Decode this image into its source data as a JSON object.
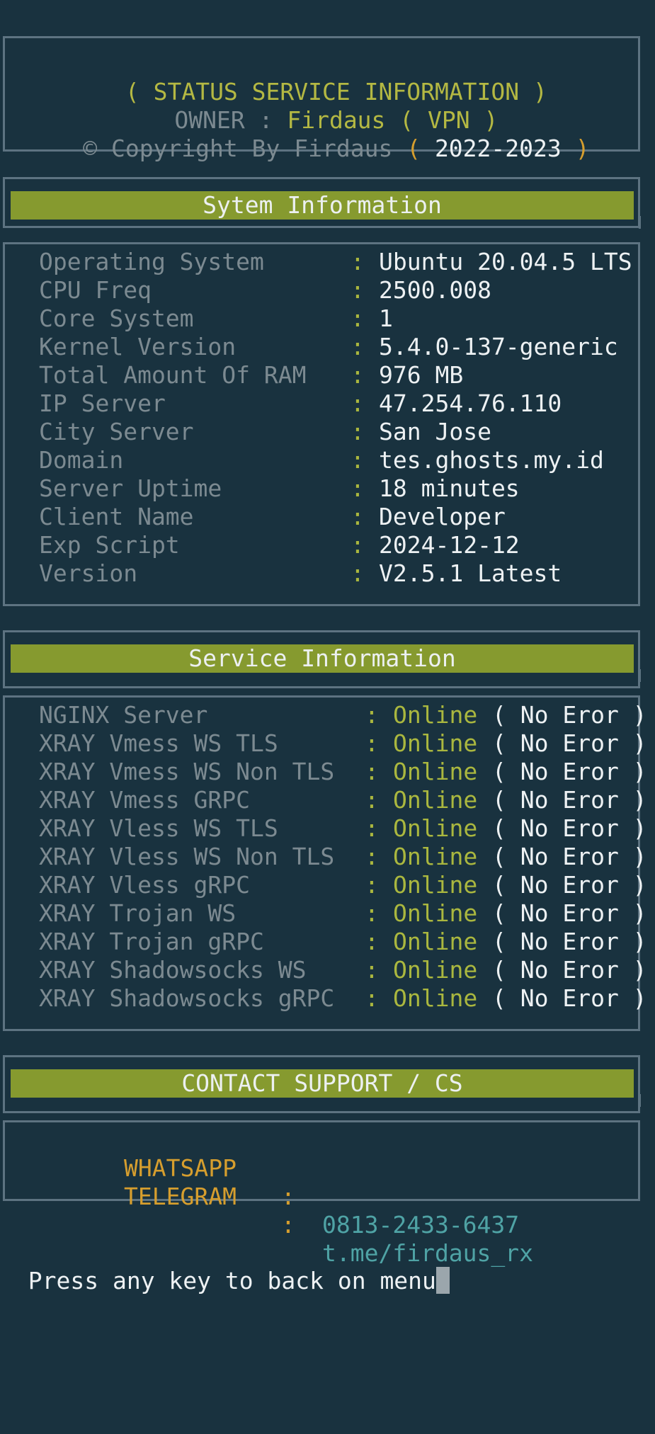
{
  "header": {
    "title_open": "( ",
    "title": "STATUS SERVICE INFORMATION",
    "title_close": " )",
    "owner_label": "OWNER",
    "owner_sep": " : ",
    "owner_value": "Firdaus ( VPN )",
    "copyright_text": "© Copyright By Firdaus",
    "copyright_open": " ( ",
    "copyright_years": "2022-2023",
    "copyright_close": " )"
  },
  "system": {
    "heading": "Sytem Information",
    "separator": ":",
    "rows": [
      {
        "label": "Operating System",
        "value": "Ubuntu 20.04.5 LTS"
      },
      {
        "label": "CPU Freq",
        "value": "2500.008"
      },
      {
        "label": "Core System",
        "value": "1"
      },
      {
        "label": "Kernel Version",
        "value": "5.4.0-137-generic"
      },
      {
        "label": "Total Amount Of RAM",
        "value": "976 MB"
      },
      {
        "label": "IP Server",
        "value": "47.254.76.110"
      },
      {
        "label": "City Server",
        "value": "San Jose"
      },
      {
        "label": "Domain",
        "value": "tes.ghosts.my.id"
      },
      {
        "label": "Server Uptime",
        "value": "18 minutes"
      },
      {
        "label": "Client Name",
        "value": "Developer"
      },
      {
        "label": "Exp Script",
        "value": "2024-12-12"
      },
      {
        "label": "Version",
        "value": "V2.5.1 Latest"
      }
    ]
  },
  "service": {
    "heading": "Service Information",
    "separator": ":",
    "rows": [
      {
        "label": "NGINX Server",
        "status": "Online",
        "note": "( No Eror )"
      },
      {
        "label": "XRAY Vmess WS TLS",
        "status": "Online",
        "note": "( No Eror )"
      },
      {
        "label": "XRAY Vmess WS Non TLS",
        "status": "Online",
        "note": "( No Eror )"
      },
      {
        "label": "XRAY Vmess GRPC",
        "status": "Online",
        "note": "( No Eror )"
      },
      {
        "label": "XRAY Vless WS TLS",
        "status": "Online",
        "note": "( No Eror )"
      },
      {
        "label": "XRAY Vless WS Non TLS",
        "status": "Online",
        "note": "( No Eror )"
      },
      {
        "label": "XRAY Vless gRPC",
        "status": "Online",
        "note": "( No Eror )"
      },
      {
        "label": "XRAY Trojan WS",
        "status": "Online",
        "note": "( No Eror )"
      },
      {
        "label": "XRAY Trojan gRPC",
        "status": "Online",
        "note": "( No Eror )"
      },
      {
        "label": "XRAY Shadowsocks WS",
        "status": "Online",
        "note": "( No Eror )"
      },
      {
        "label": "XRAY Shadowsocks gRPC",
        "status": "Online",
        "note": "( No Eror )"
      }
    ]
  },
  "contact": {
    "heading": "CONTACT SUPPORT / CS",
    "separator": ":",
    "whatsapp_label": "WHATSAPP",
    "whatsapp_value": "0813-2433-6437",
    "telegram_label": "TELEGRAM",
    "telegram_value": "t.me/firdaus_rx"
  },
  "prompt": {
    "text": "Press any key to back on menu"
  },
  "colors": {
    "background": "#19323f",
    "banner": "#869a2f",
    "label": "#7c8a91",
    "value": "#edf1f3",
    "online": "#aab73f",
    "contact_label": "#d69e2e",
    "contact_value": "#4fa3a5"
  }
}
